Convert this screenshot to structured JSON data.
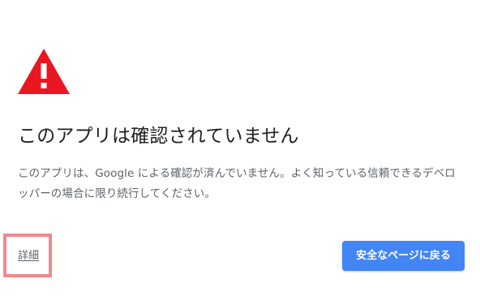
{
  "colors": {
    "warning_red": "#ea1622",
    "title_text": "#202124",
    "body_text": "#5f6368",
    "button_blue": "#4285f4",
    "highlight_pink": "#f0898b"
  },
  "icons": {
    "warning": "warning-triangle-icon"
  },
  "main": {
    "title": "このアプリは確認されていません",
    "message": "このアプリは、Google による確認が済んでいません。よく知っている信頼できるデベロッパーの場合に限り続行してください。",
    "details_link": "詳細",
    "back_button": "安全なページに戻る"
  }
}
